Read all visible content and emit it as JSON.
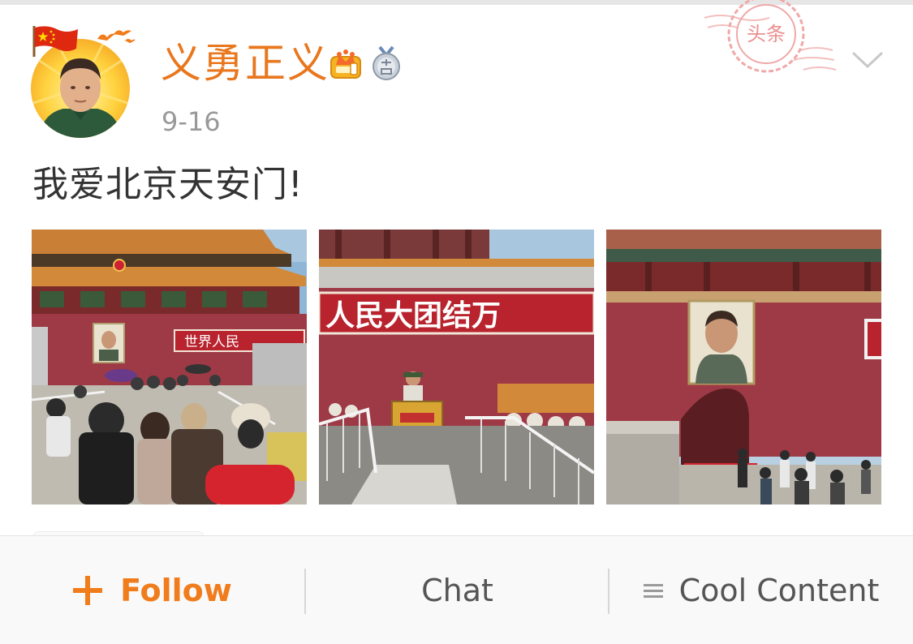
{
  "post": {
    "username": "义勇正义",
    "time": "9-16",
    "text": "我爱北京天安门!",
    "badges": [
      "crown-badge-icon",
      "answer-medal-icon"
    ],
    "stamp_text": "头条",
    "photos": [
      {
        "banner_text": "世界人民",
        "description": "tiananmen-queue"
      },
      {
        "banner_text": "人民大团结万",
        "description": "tiananmen-guard"
      },
      {
        "banner_text": "",
        "description": "tiananmen-gate-portrait"
      }
    ]
  },
  "bottom_bar": {
    "follow_label": "Follow",
    "chat_label": "Chat",
    "cool_label": "Cool Content"
  },
  "colors": {
    "accent": "#f07c1c",
    "username": "#e8771e",
    "wall_red": "#9e3a46",
    "roof": "#d28a3a"
  }
}
